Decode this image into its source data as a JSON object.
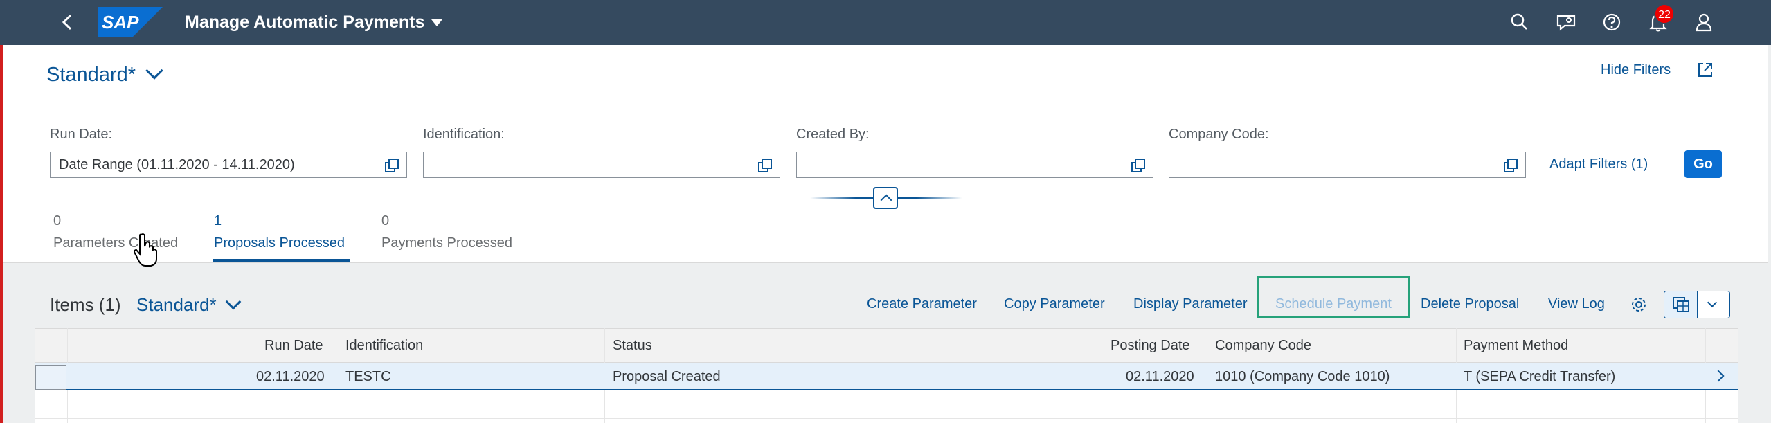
{
  "shell": {
    "app_title": "Manage Automatic Payments",
    "logo_text": "SAP",
    "notification_count": "22"
  },
  "filterbar": {
    "variant": "Standard*",
    "hide_filters": "Hide Filters",
    "fields": [
      {
        "label": "Run Date:",
        "value": "Date Range (01.11.2020 - 14.11.2020)"
      },
      {
        "label": "Identification:",
        "value": ""
      },
      {
        "label": "Created By:",
        "value": ""
      },
      {
        "label": "Company Code:",
        "value": ""
      }
    ],
    "adapt_filters": "Adapt Filters (1)",
    "go": "Go"
  },
  "tabs": [
    {
      "count": "0",
      "label": "Parameters Created"
    },
    {
      "count": "1",
      "label": "Proposals Processed"
    },
    {
      "count": "0",
      "label": "Payments Processed"
    }
  ],
  "table": {
    "title": "Items (1)",
    "variant": "Standard*",
    "actions": [
      "Create Parameter",
      "Copy Parameter",
      "Display Parameter",
      "Schedule Payment",
      "Delete Proposal",
      "View Log"
    ],
    "columns": [
      "Run Date",
      "Identification",
      "Status",
      "Posting Date",
      "Company Code",
      "Payment Method"
    ],
    "rows": [
      [
        "02.11.2020",
        "TESTC",
        "Proposal Created",
        "02.11.2020",
        "1010 (Company Code 1010)",
        "T (SEPA Credit Transfer)"
      ]
    ]
  },
  "colors": {
    "shell": "#354a5f",
    "accent": "#0a5596",
    "go_button": "#0a6ed1",
    "highlight_frame": "#26a27a"
  }
}
